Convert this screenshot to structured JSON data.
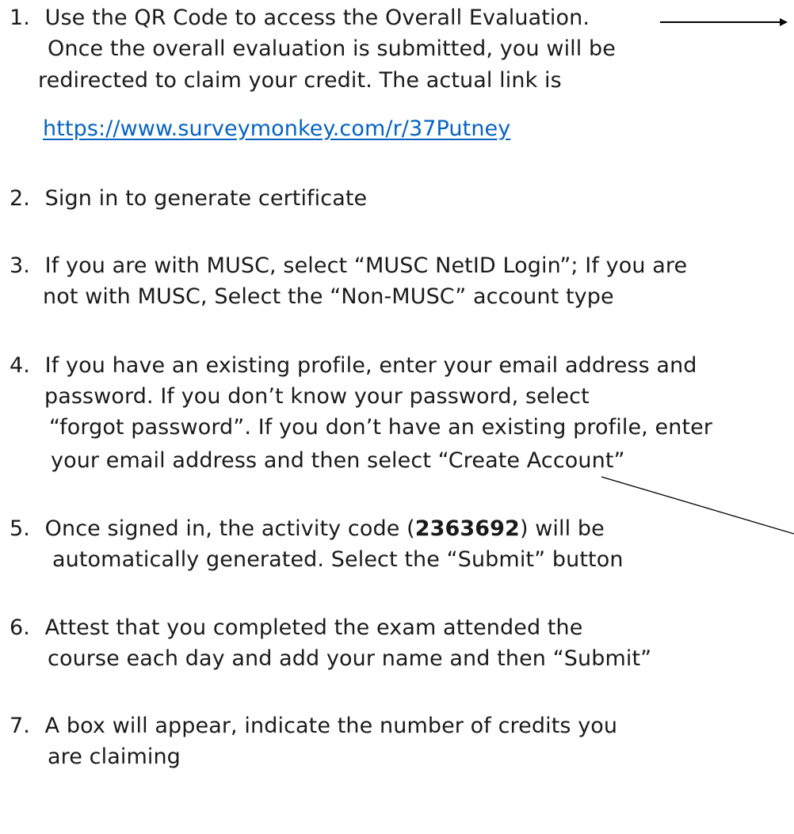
{
  "steps": [
    {
      "number": "1.",
      "lines": [
        "Use the QR Code to access the Overall Evaluation.",
        "Once the overall evaluation is submitted, you will be",
        "redirected to claim your credit. The actual link is"
      ],
      "link": "https://www.surveymonkey.com/r/37Putney"
    },
    {
      "number": "2.",
      "lines": [
        "Sign in to generate certificate"
      ]
    },
    {
      "number": "3.",
      "lines": [
        "If you are with MUSC, select “MUSC NetID Login”; If you are",
        "not with MUSC, Select the “Non-MUSC” account type"
      ]
    },
    {
      "number": "4.",
      "lines": [
        "If you have an existing profile, enter your email address and",
        "password. If you don’t know your password, select",
        "“forgot password”. If you don’t have an existing profile, enter",
        "your email address and then select “Create Account”"
      ]
    },
    {
      "number": "5.",
      "line1_before": "Once signed in, the activity code (",
      "activity_code": "2363692",
      "line1_after": ") will be",
      "lines": [
        "automatically generated.  Select the “Submit” button"
      ]
    },
    {
      "number": "6.",
      "lines": [
        "Attest that you completed the exam attended the",
        "course each day and add your name and then “Submit”"
      ]
    },
    {
      "number": "7.",
      "lines": [
        "A box will appear, indicate the number of credits you",
        "are claiming"
      ]
    }
  ]
}
